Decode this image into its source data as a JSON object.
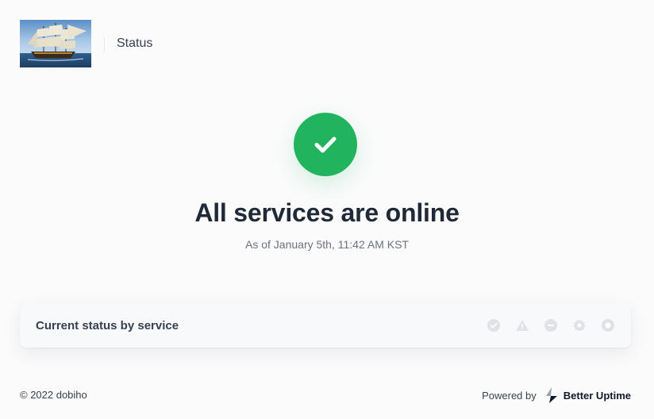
{
  "header": {
    "logo_alt": "dobiho",
    "nav_label": "Status"
  },
  "hero": {
    "icon": "check-icon",
    "headline": "All services are online",
    "timestamp": "As of January 5th, 11:42 AM KST",
    "accent_color": "#22b35e"
  },
  "services": {
    "title": "Current status by service",
    "legend_icons": [
      "operational-icon",
      "degraded-icon",
      "downtime-icon",
      "maintenance-icon",
      "not-monitored-icon"
    ]
  },
  "footer": {
    "copyright": "© 2022 dobiho",
    "powered_by": "Powered by",
    "brand": "Better Uptime"
  }
}
